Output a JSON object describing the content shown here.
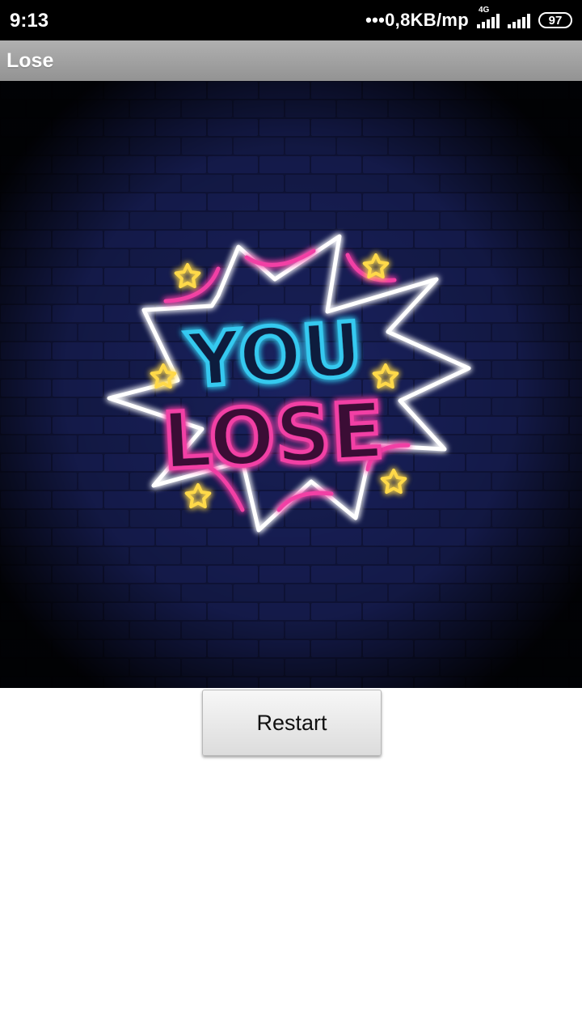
{
  "status_bar": {
    "time": "9:13",
    "net_speed": "•••0,8KB/mp",
    "network_type": "4G",
    "battery_level": "97"
  },
  "app_bar": {
    "title": "Lose"
  },
  "artwork": {
    "line1": "YOU",
    "line2": "LOSE",
    "colors": {
      "wall": "#141a4a",
      "cyan": "#35c9f0",
      "pink": "#f23fa5",
      "white": "#ffffff",
      "star": "#ffd94a"
    }
  },
  "actions": {
    "restart_label": "Restart"
  }
}
